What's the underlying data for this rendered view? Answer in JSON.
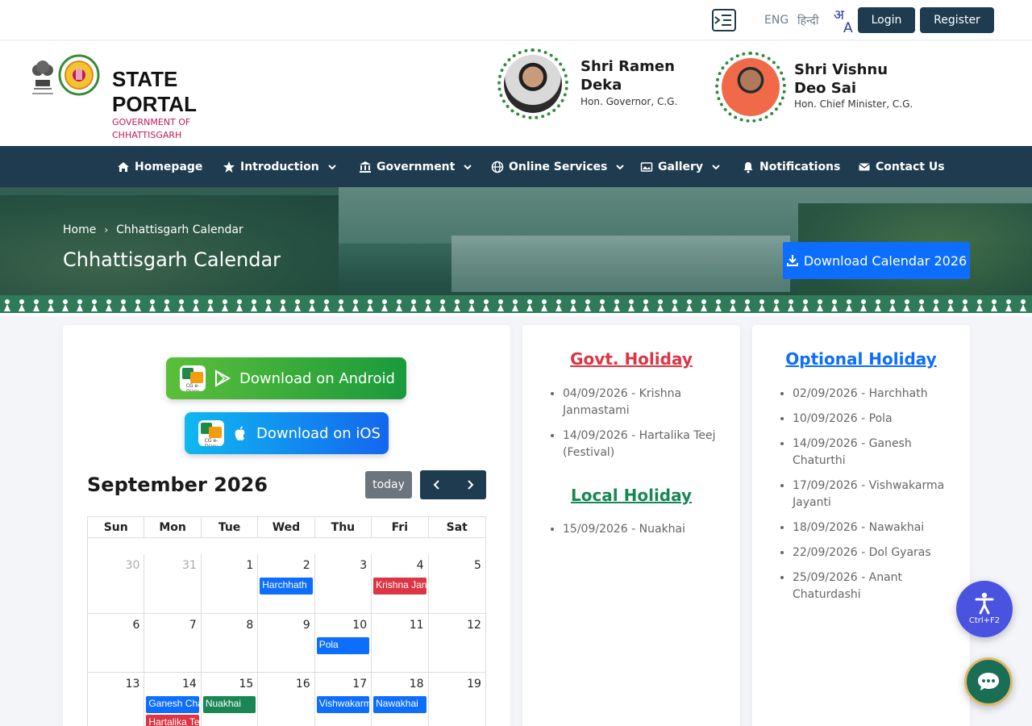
{
  "topbar": {
    "lang_eng": "ENG",
    "lang_hindi": "हिन्दी",
    "login_label": "Login",
    "register_label": "Register"
  },
  "header": {
    "title": "STATE PORTAL",
    "subtitle": "GOVERNMENT OF CHHATTISGARH",
    "governor_name": "Shri Ramen Deka",
    "governor_role": "Hon. Governor, C.G.",
    "cm_name": "Shri Vishnu Deo Sai",
    "cm_role": "Hon. Chief Minister, C.G."
  },
  "nav": {
    "items": [
      {
        "label": "Homepage",
        "icon": "home-icon"
      },
      {
        "label": "Introduction",
        "icon": "star-icon"
      },
      {
        "label": "Government",
        "icon": "bank-icon"
      },
      {
        "label": "Online Services",
        "icon": "globe-icon"
      },
      {
        "label": "Gallery",
        "icon": "image-icon"
      },
      {
        "label": "Notifications",
        "icon": "bell-icon"
      },
      {
        "label": "Contact Us",
        "icon": "envelope-icon"
      }
    ]
  },
  "banner": {
    "breadcrumb_home": "Home",
    "breadcrumb_current": "Chhattisgarh Calendar",
    "page_title": "Chhattisgarh Calendar",
    "download_label": "Download Calendar 2026"
  },
  "apps": {
    "android_label": "Download on Android",
    "ios_label": "Download on iOS",
    "logo_text": "CG e-Diary"
  },
  "calendar": {
    "month_title": "September 2026",
    "today_label": "today",
    "weekdays": [
      "Sun",
      "Mon",
      "Tue",
      "Wed",
      "Thu",
      "Fri",
      "Sat"
    ],
    "weeks": [
      [
        {
          "day": "30",
          "muted": true,
          "events": []
        },
        {
          "day": "31",
          "muted": true,
          "events": []
        },
        {
          "day": "1",
          "events": []
        },
        {
          "day": "2",
          "events": [
            {
              "title": "Harchhath",
              "type": "optional"
            }
          ]
        },
        {
          "day": "3",
          "events": []
        },
        {
          "day": "4",
          "events": [
            {
              "title": "Krishna Janmastami",
              "type": "govt"
            }
          ]
        },
        {
          "day": "5",
          "events": []
        }
      ],
      [
        {
          "day": "6",
          "events": []
        },
        {
          "day": "7",
          "events": []
        },
        {
          "day": "8",
          "events": []
        },
        {
          "day": "9",
          "events": []
        },
        {
          "day": "10",
          "events": [
            {
              "title": "Pola",
              "type": "optional"
            }
          ]
        },
        {
          "day": "11",
          "events": []
        },
        {
          "day": "12",
          "events": []
        }
      ],
      [
        {
          "day": "13",
          "events": []
        },
        {
          "day": "14",
          "events": [
            {
              "title": "Ganesh Chaturthi",
              "type": "optional"
            },
            {
              "title": "Hartalika Teej",
              "type": "govt"
            }
          ]
        },
        {
          "day": "15",
          "events": [
            {
              "title": "Nuakhai",
              "type": "local"
            }
          ]
        },
        {
          "day": "16",
          "events": []
        },
        {
          "day": "17",
          "events": [
            {
              "title": "Vishwakarma Jayanti",
              "type": "optional"
            }
          ]
        },
        {
          "day": "18",
          "events": [
            {
              "title": "Nawakhai",
              "type": "optional"
            }
          ]
        },
        {
          "day": "19",
          "events": []
        }
      ]
    ]
  },
  "holidays": {
    "govt_title": "Govt. Holiday",
    "govt": [
      "04/09/2026 - Krishna Janmastami",
      "14/09/2026 - Hartalika Teej (Festival)"
    ],
    "local_title": "Local Holiday",
    "local": [
      "15/09/2026 - Nuakhai"
    ],
    "optional_title": "Optional Holiday",
    "optional": [
      "02/09/2026 - Harchhath",
      "10/09/2026 - Pola",
      "14/09/2026 - Ganesh Chaturthi",
      "17/09/2026 - Vishwakarma Jayanti",
      "18/09/2026 - Nawakhai",
      "22/09/2026 - Dol Gyaras",
      "25/09/2026 - Anant Chaturdashi"
    ]
  },
  "widgets": {
    "a11y_shortcut": "Ctrl+F2"
  },
  "colors": {
    "navy": "#1e3b4f",
    "primary": "#0d6efd",
    "govt_red": "#dc3545",
    "local_green": "#198754",
    "subtitle_pink": "#c2185b"
  }
}
